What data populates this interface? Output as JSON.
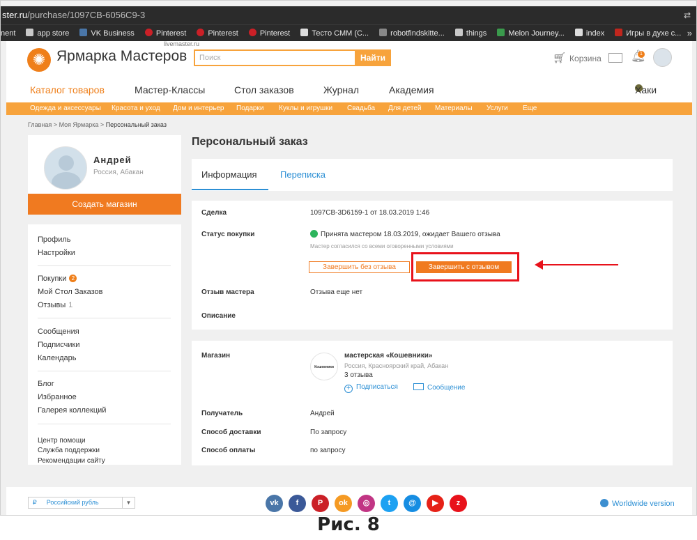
{
  "browser": {
    "url_prefix": "ster.ru",
    "url_path": "/purchase/1097CB-6056C9-3",
    "bookmarks": [
      {
        "label": "nent",
        "icon": "none"
      },
      {
        "label": "app store",
        "icon": "folder-icon"
      },
      {
        "label": "VK Business",
        "icon": "vk-icon"
      },
      {
        "label": "Pinterest",
        "icon": "pinterest-icon"
      },
      {
        "label": "Pinterest",
        "icon": "pinterest-icon"
      },
      {
        "label": "Pinterest",
        "icon": "pinterest-icon"
      },
      {
        "label": "Тесто СММ (С...",
        "icon": "page-icon"
      },
      {
        "label": "robotfindskitte...",
        "icon": "puzzle-icon"
      },
      {
        "label": "things",
        "icon": "folder-icon"
      },
      {
        "label": "Melon Journey...",
        "icon": "melon-icon"
      },
      {
        "label": "index",
        "icon": "page-icon"
      },
      {
        "label": "Игры в духе с...",
        "icon": "game-icon"
      }
    ]
  },
  "header": {
    "logo": "Ярмарка Мастеров",
    "logo_sub": "livemaster.ru",
    "search_placeholder": "Поиск",
    "search_button": "Найти",
    "cart": "Корзина",
    "notif_count": "1",
    "nav": [
      "Каталог товаров",
      "Мастер-Классы",
      "Стол заказов",
      "Журнал",
      "Академия"
    ],
    "user_nav": "Хаки",
    "categories": [
      "Одежда и аксессуары",
      "Красота и уход",
      "Дом и интерьер",
      "Подарки",
      "Куклы и игрушки",
      "Свадьба",
      "Для детей",
      "Материалы",
      "Услуги",
      "Еще"
    ]
  },
  "breadcrumbs": {
    "home": "Главная",
    "sep": ">",
    "mine": "Моя Ярмарка",
    "current": "Персональный заказ"
  },
  "profile": {
    "name": "Андрей",
    "location": "Россия, Абакан",
    "create_shop": "Создать магазин"
  },
  "sidebar": {
    "profile": "Профиль",
    "settings": "Настройки",
    "purchases": "Покупки",
    "purchases_badge": "2",
    "order_table": "Мой Стол Заказов",
    "reviews": "Отзывы",
    "reviews_count": "1",
    "messages": "Сообщения",
    "subscribers": "Подписчики",
    "calendar": "Календарь",
    "blog": "Блог",
    "favorites": "Избранное",
    "gallery": "Галерея коллекций",
    "help": "Центр помощи",
    "support": "Служба поддержки",
    "recommend": "Рекомендации сайту"
  },
  "order": {
    "title": "Персональный заказ",
    "tab_info": "Информация",
    "tab_chat": "Переписка",
    "deal_label": "Сделка",
    "deal_value": "1097CB-3D6159-1 от 18.03.2019 1:46",
    "status_label": "Статус покупки",
    "status_value": "Принята мастером 18.03.2019, ожидает Вашего отзыва",
    "status_note": "Мастер согласился со всеми оговоренными условиями",
    "btn_no_review": "Завершить без отзыва",
    "btn_with_review": "Завершить с отзывом",
    "master_review_label": "Отзыв мастера",
    "master_review_value": "Отзыва еще нет",
    "description_label": "Описание",
    "status_color": "#2db55d"
  },
  "shop": {
    "label": "Магазин",
    "logo_text": "Кошевники",
    "name": "мастерская «Кошевники»",
    "location": "Россия, Красноярский край, Абакан",
    "reviews": "3 отзыва",
    "subscribe": "Подписаться",
    "message": "Сообщение",
    "recipient_label": "Получатель",
    "recipient_value": "Андрей",
    "delivery_label": "Способ доставки",
    "delivery_value": "По запросу",
    "payment_label": "Способ оплаты",
    "payment_value": "по запросу"
  },
  "footer": {
    "currency": "Российский рубль",
    "socials": [
      {
        "name": "vk-icon",
        "glyph": "vk",
        "color": "#4a76a8"
      },
      {
        "name": "facebook-icon",
        "glyph": "f",
        "color": "#3b5998"
      },
      {
        "name": "pinterest-icon",
        "glyph": "P",
        "color": "#cb2027"
      },
      {
        "name": "odnoklassniki-icon",
        "glyph": "ok",
        "color": "#f59a23"
      },
      {
        "name": "instagram-icon",
        "glyph": "◎",
        "color": "#c13584"
      },
      {
        "name": "twitter-icon",
        "glyph": "t",
        "color": "#1da1f2"
      },
      {
        "name": "mail-ru-icon",
        "glyph": "@",
        "color": "#168de2"
      },
      {
        "name": "youtube-icon",
        "glyph": "▶",
        "color": "#e62117"
      },
      {
        "name": "zen-icon",
        "glyph": "z",
        "color": "#e8121b"
      }
    ],
    "worldwide": "Worldwide version"
  },
  "caption": "Рис. 8",
  "colors": {
    "accent": "#ef7f1a",
    "link": "#2c8fd4",
    "highlight": "#e8121b"
  }
}
